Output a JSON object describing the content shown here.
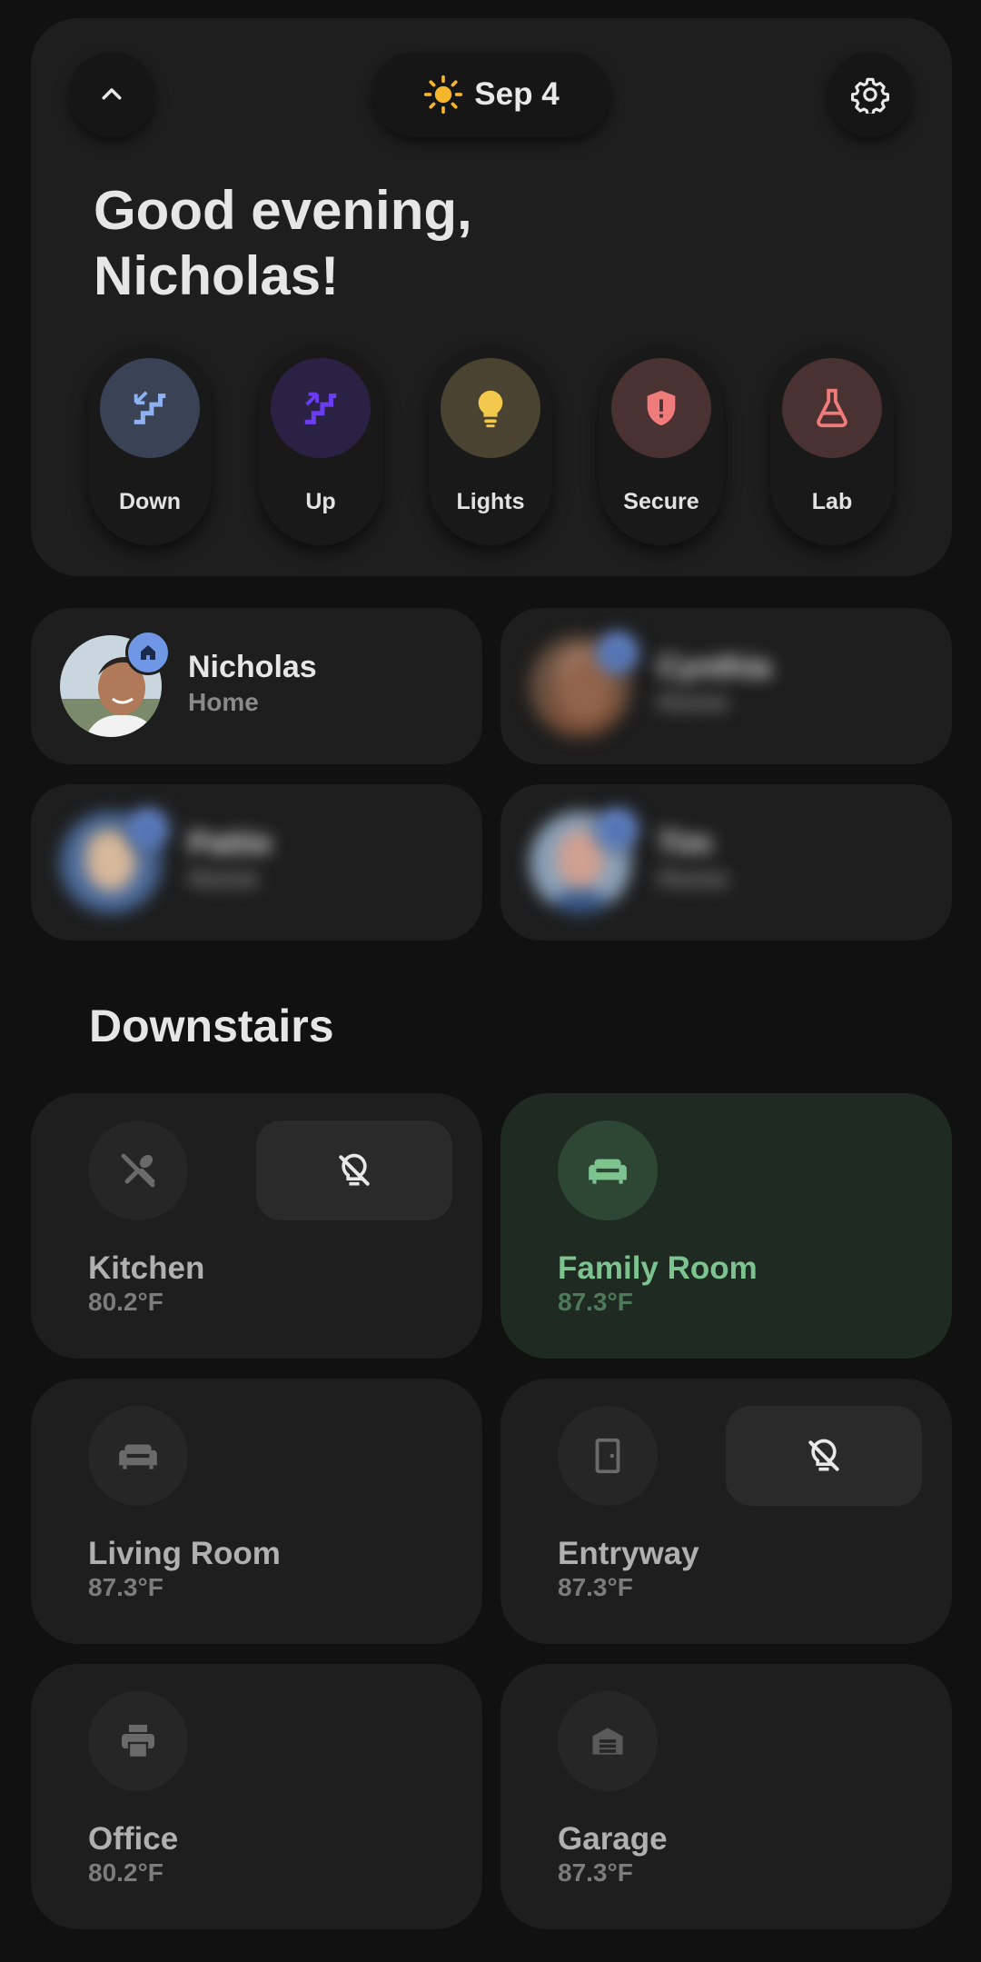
{
  "header": {
    "date": "Sep 4",
    "greeting_line1": "Good evening,",
    "greeting_line2": "Nicholas!"
  },
  "scenes": [
    {
      "label": "Down",
      "icon": "stairs-down-icon",
      "color": "#8fb1f0",
      "bg": "#3a4255"
    },
    {
      "label": "Up",
      "icon": "stairs-up-icon",
      "color": "#6a3df0",
      "bg": "#2a2245"
    },
    {
      "label": "Lights",
      "icon": "lightbulb-icon",
      "color": "#f2c94c",
      "bg": "#4a4332"
    },
    {
      "label": "Secure",
      "icon": "shield-alert-icon",
      "color": "#ef7b7b",
      "bg": "#4a3232"
    },
    {
      "label": "Lab",
      "icon": "flask-icon",
      "color": "#ef7b7b",
      "bg": "#4a3232"
    }
  ],
  "people": [
    {
      "name": "Nicholas",
      "status": "Home"
    },
    {
      "name": "Cynthia",
      "status": "Home"
    },
    {
      "name": "Pattie",
      "status": "Home"
    },
    {
      "name": "Tim",
      "status": "Home"
    }
  ],
  "section": {
    "title": "Downstairs"
  },
  "rooms": [
    {
      "name": "Kitchen",
      "temp": "80.2°F",
      "icon": "utensils-off-icon"
    },
    {
      "name": "Family Room",
      "temp": "87.3°F",
      "icon": "sofa-icon"
    },
    {
      "name": "Living Room",
      "temp": "87.3°F",
      "icon": "sofa-icon"
    },
    {
      "name": "Entryway",
      "temp": "87.3°F",
      "icon": "door-icon"
    },
    {
      "name": "Office",
      "temp": "80.2°F",
      "icon": "printer-icon"
    },
    {
      "name": "Garage",
      "temp": "87.3°F",
      "icon": "garage-icon"
    }
  ],
  "colors": {
    "background": "#111111",
    "card": "#1e1e1e",
    "active_card": "#1f2a22",
    "active_text": "#7dc390",
    "badge": "#6f97e6",
    "sun": "#f6b62b"
  }
}
